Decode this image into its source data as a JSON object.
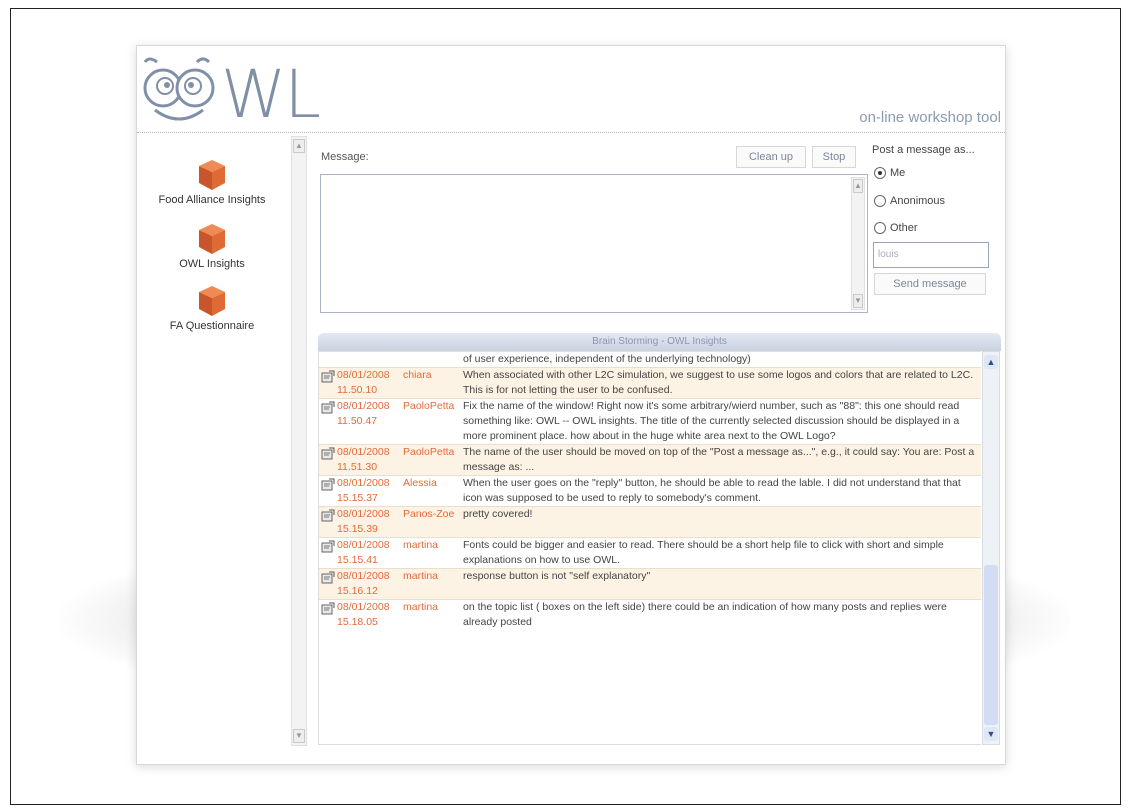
{
  "app": {
    "logo_text": "WL",
    "tagline": "on-line workshop tool"
  },
  "sidebar": {
    "topics": [
      {
        "label": "Food Alliance Insights"
      },
      {
        "label": "OWL Insights"
      },
      {
        "label": "FA Questionnaire"
      }
    ]
  },
  "composer": {
    "message_label": "Message:",
    "cleanup_label": "Clean up",
    "stop_label": "Stop",
    "message_value": ""
  },
  "post_as": {
    "title": "Post a message as...",
    "options": [
      {
        "label": "Me",
        "selected": true
      },
      {
        "label": "Anonimous",
        "selected": false
      },
      {
        "label": "Other",
        "selected": false
      }
    ],
    "name_placeholder": "louis",
    "send_label": "Send message"
  },
  "feed": {
    "title": "Brain Storming - OWL Insights",
    "rows": [
      {
        "date": "",
        "time": "",
        "user": "",
        "text": "of user experience, independent of the underlying technology)",
        "alt": false,
        "icon": false
      },
      {
        "date": "08/01/2008",
        "time": "11.50.10",
        "user": "chiara",
        "text": "When associated with other L2C simulation, we suggest to use some logos and colors that are related to L2C. This is for not letting the user to be confused.",
        "alt": true,
        "icon": true
      },
      {
        "date": "08/01/2008",
        "time": "11.50.47",
        "user": "PaoloPetta",
        "text": "Fix the name of the window! Right now it's some arbitrary/wierd number, such as \"88\": this one should read something like: OWL -- OWL insights. The title of the currently selected discussion should be displayed in a more prominent place. how about in the huge white area next to the OWL Logo?",
        "alt": false,
        "icon": true
      },
      {
        "date": "08/01/2008",
        "time": "11.51.30",
        "user": "PaoloPetta",
        "text": "The name of the user should be moved on top of the \"Post a message as...\", e.g., it could say: You are: Post a message as: ...",
        "alt": true,
        "icon": true
      },
      {
        "date": "08/01/2008",
        "time": "15.15.37",
        "user": "Alessia",
        "text": "When the user goes on the \"reply\" button, he should be able to read the lable. I did not understand that that icon was supposed to be used to reply to somebody's comment.",
        "alt": false,
        "icon": true
      },
      {
        "date": "08/01/2008",
        "time": "15.15.39",
        "user": "Panos-Zoe",
        "text": "pretty covered!",
        "alt": true,
        "icon": true
      },
      {
        "date": "08/01/2008",
        "time": "15.15.41",
        "user": "martina",
        "text": "Fonts could be bigger and easier to read. There should be a short help file to click with short and simple explanations on how to use OWL.",
        "alt": false,
        "icon": true
      },
      {
        "date": "08/01/2008",
        "time": "15.16.12",
        "user": "martina",
        "text": "response button is not \"self explanatory\"",
        "alt": true,
        "icon": true
      },
      {
        "date": "08/01/2008",
        "time": "15.18.05",
        "user": "martina",
        "text": "on the topic list ( boxes on the left side) there could be an indication of how many posts and replies were already posted",
        "alt": false,
        "icon": true
      }
    ]
  },
  "colors": {
    "accent": "#e46a3a",
    "logo": "#7f8fa6",
    "row_alt": "#fdf3e4"
  }
}
